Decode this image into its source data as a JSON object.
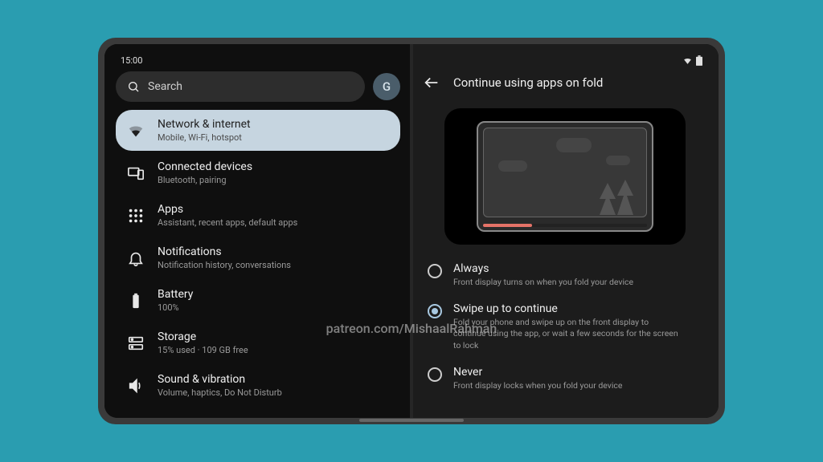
{
  "statusbar": {
    "time": "15:00"
  },
  "search": {
    "placeholder": "Search",
    "avatar_letter": "G"
  },
  "settings": [
    {
      "key": "network",
      "title": "Network & internet",
      "sub": "Mobile, Wi-Fi, hotspot",
      "selected": true,
      "icon": "wifi-icon"
    },
    {
      "key": "connected",
      "title": "Connected devices",
      "sub": "Bluetooth, pairing",
      "selected": false,
      "icon": "devices-icon"
    },
    {
      "key": "apps",
      "title": "Apps",
      "sub": "Assistant, recent apps, default apps",
      "selected": false,
      "icon": "apps-icon"
    },
    {
      "key": "notifications",
      "title": "Notifications",
      "sub": "Notification history, conversations",
      "selected": false,
      "icon": "bell-icon"
    },
    {
      "key": "battery",
      "title": "Battery",
      "sub": "100%",
      "selected": false,
      "icon": "battery-icon"
    },
    {
      "key": "storage",
      "title": "Storage",
      "sub": "15% used · 109 GB free",
      "selected": false,
      "icon": "storage-icon"
    },
    {
      "key": "sound",
      "title": "Sound & vibration",
      "sub": "Volume, haptics, Do Not Disturb",
      "selected": false,
      "icon": "sound-icon"
    }
  ],
  "detail": {
    "title": "Continue using apps on fold",
    "options": [
      {
        "key": "always",
        "title": "Always",
        "sub": "Front display turns on when you fold your device",
        "checked": false
      },
      {
        "key": "swipe",
        "title": "Swipe up to continue",
        "sub": "Fold your phone and swipe up on the front display to continue using the app, or wait a few seconds for the screen to lock",
        "checked": true
      },
      {
        "key": "never",
        "title": "Never",
        "sub": "Front display locks when you fold your device",
        "checked": false
      }
    ]
  },
  "watermark": "patreon.com/MishaalRahman"
}
